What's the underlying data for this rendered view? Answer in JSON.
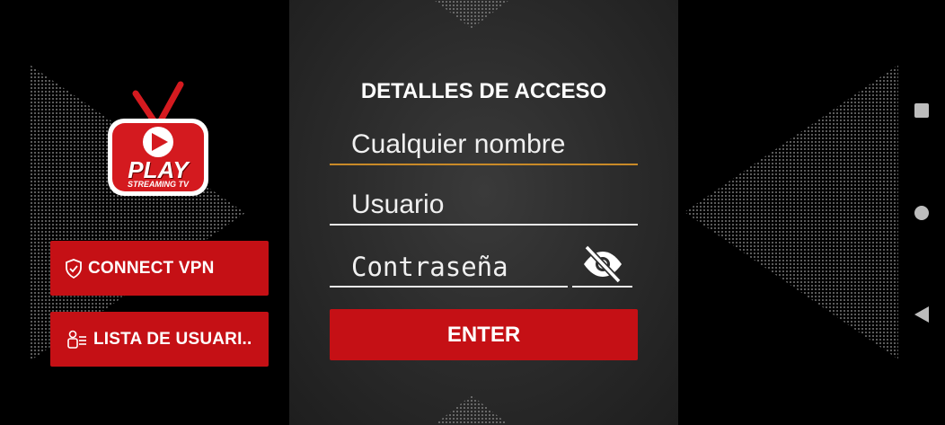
{
  "logo": {
    "brand": "PLAY",
    "tagline": "STREAMING TV"
  },
  "sidebar": {
    "connect_vpn": "CONNECT VPN",
    "user_list": "LISTA DE USUARI.."
  },
  "form": {
    "title": "DETALLES DE ACCESO",
    "name_placeholder": "Cualquier nombre",
    "user_placeholder": "Usuario",
    "password_placeholder": "Contraseña",
    "submit_label": "ENTER"
  },
  "colors": {
    "accent_red": "#c51015",
    "focus_underline": "#c98a28",
    "panel": "#2e2e2e"
  },
  "icons": [
    "shield-icon",
    "user-list-icon",
    "eye-slash-icon",
    "square-icon",
    "circle-icon",
    "back-triangle-icon"
  ]
}
